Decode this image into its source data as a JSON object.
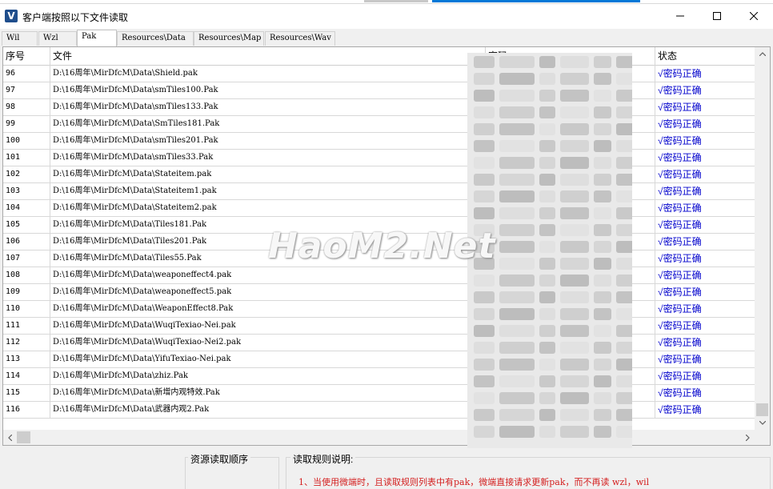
{
  "window": {
    "title": "客户端按照以下文件读取",
    "icon": "app-logo-v-icon",
    "controls": [
      "minimize-icon",
      "maximize-icon",
      "close-icon"
    ]
  },
  "tabs": [
    {
      "label": "Wil",
      "active": false
    },
    {
      "label": "Wzl",
      "active": false
    },
    {
      "label": "Pak",
      "active": true
    },
    {
      "label": "Resources\\Data",
      "active": false
    },
    {
      "label": "Resources\\Map",
      "active": false
    },
    {
      "label": "Resources\\Wav",
      "active": false
    }
  ],
  "table": {
    "columns": [
      "序号",
      "文件",
      "密码",
      "状态"
    ],
    "rows": [
      {
        "num": "96",
        "file": "D:\\16周年\\MirDfcM\\Data\\Shield.pak",
        "status": "√密码正确"
      },
      {
        "num": "97",
        "file": "D:\\16周年\\MirDfcM\\Data\\smTiles100.Pak",
        "status": "√密码正确"
      },
      {
        "num": "98",
        "file": "D:\\16周年\\MirDfcM\\Data\\smTiles133.Pak",
        "status": "√密码正确"
      },
      {
        "num": "99",
        "file": "D:\\16周年\\MirDfcM\\Data\\SmTiles181.Pak",
        "status": "√密码正确"
      },
      {
        "num": "100",
        "file": "D:\\16周年\\MirDfcM\\Data\\smTiles201.Pak",
        "status": "√密码正确"
      },
      {
        "num": "101",
        "file": "D:\\16周年\\MirDfcM\\Data\\smTiles33.Pak",
        "status": "√密码正确"
      },
      {
        "num": "102",
        "file": "D:\\16周年\\MirDfcM\\Data\\Stateitem.pak",
        "status": "√密码正确"
      },
      {
        "num": "103",
        "file": "D:\\16周年\\MirDfcM\\Data\\Stateitem1.pak",
        "status": "√密码正确"
      },
      {
        "num": "104",
        "file": "D:\\16周年\\MirDfcM\\Data\\Stateitem2.pak",
        "status": "√密码正确"
      },
      {
        "num": "105",
        "file": "D:\\16周年\\MirDfcM\\Data\\Tiles181.Pak",
        "status": "√密码正确"
      },
      {
        "num": "106",
        "file": "D:\\16周年\\MirDfcM\\Data\\Tiles201.Pak",
        "status": "√密码正确"
      },
      {
        "num": "107",
        "file": "D:\\16周年\\MirDfcM\\Data\\Tiles55.Pak",
        "status": "√密码正确"
      },
      {
        "num": "108",
        "file": "D:\\16周年\\MirDfcM\\Data\\weaponeffect4.pak",
        "status": "√密码正确"
      },
      {
        "num": "109",
        "file": "D:\\16周年\\MirDfcM\\Data\\weaponeffect5.pak",
        "status": "√密码正确"
      },
      {
        "num": "110",
        "file": "D:\\16周年\\MirDfcM\\Data\\WeaponEffect8.Pak",
        "status": "√密码正确"
      },
      {
        "num": "111",
        "file": "D:\\16周年\\MirDfcM\\Data\\WuqiTexiao-Nei.pak",
        "status": "√密码正确"
      },
      {
        "num": "112",
        "file": "D:\\16周年\\MirDfcM\\Data\\WuqiTexiao-Nei2.pak",
        "status": "√密码正确"
      },
      {
        "num": "113",
        "file": "D:\\16周年\\MirDfcM\\Data\\YifuTexiao-Nei.pak",
        "status": "√密码正确"
      },
      {
        "num": "114",
        "file": "D:\\16周年\\MirDfcM\\Data\\zhiz.Pak",
        "status": "√密码正确"
      },
      {
        "num": "115",
        "file": "D:\\16周年\\MirDfcM\\Data\\新增内观特效.Pak",
        "status": "√密码正确"
      },
      {
        "num": "116",
        "file": "D:\\16周年\\MirDfcM\\Data\\武器内观2.Pak",
        "status": "√密码正确"
      }
    ]
  },
  "watermark": "HaoM2.Net",
  "bottom": {
    "left_group_label": "资源读取顺序",
    "right_group_label": "读取规则说明:",
    "rule_line": "1、当使用微端时，且读取规则列表中有pak，微端直接请求更新pak，而不再读 wzl，wil"
  },
  "colors": {
    "status_text": "#0000cc",
    "rule_text": "#d42020",
    "accent": "#0078d7"
  }
}
